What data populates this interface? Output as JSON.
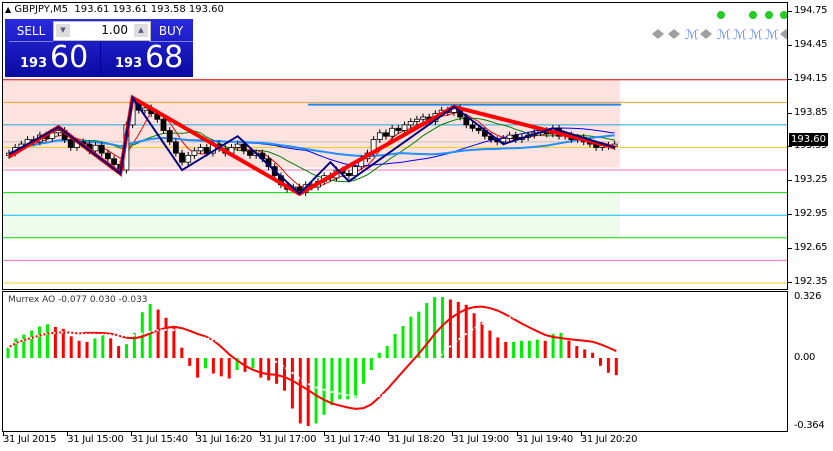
{
  "header": {
    "symbol": "GBPJPY,M5",
    "quote": "193.61 193.61 193.58 193.60"
  },
  "trade_panel": {
    "sell_label": "SELL",
    "buy_label": "BUY",
    "volume": "1.00",
    "sell_big": "193",
    "sell_pips": "60",
    "buy_big": "193",
    "buy_pips": "68"
  },
  "price_axis": [
    "194.75",
    "194.45",
    "194.15",
    "193.85",
    "193.55",
    "193.25",
    "192.95",
    "192.65",
    "192.35"
  ],
  "current_price": "193.60",
  "levels": [
    {
      "p": 194.15,
      "c": "#e00000"
    },
    {
      "p": 193.95,
      "c": "#f0a020"
    },
    {
      "p": 193.75,
      "c": "#20a8e0"
    },
    {
      "p": 193.55,
      "c": "#f0d020"
    },
    {
      "p": 193.35,
      "c": "#ff69b4"
    },
    {
      "p": 193.15,
      "c": "#00e000"
    },
    {
      "p": 192.95,
      "c": "#00bfff"
    },
    {
      "p": 192.75,
      "c": "#00e000"
    },
    {
      "p": 192.55,
      "c": "#ff69b4"
    },
    {
      "p": 192.35,
      "c": "#f0d020"
    }
  ],
  "colors": {
    "bull_zone": "#fde3e0",
    "bear_zone": "#effcec",
    "zigzag_red": "#ff0000",
    "zigzag_blue": "#000080",
    "ao_up": "#00ee00",
    "ao_down": "#ff0000"
  },
  "closes": [
    193.5,
    193.55,
    193.58,
    193.62,
    193.6,
    193.66,
    193.63,
    193.68,
    193.7,
    193.62,
    193.55,
    193.6,
    193.58,
    193.52,
    193.57,
    193.5,
    193.45,
    193.4,
    193.35,
    193.75,
    193.95,
    193.88,
    193.9,
    193.85,
    193.8,
    193.7,
    193.6,
    193.5,
    193.42,
    193.48,
    193.52,
    193.55,
    193.5,
    193.58,
    193.54,
    193.5,
    193.55,
    193.58,
    193.52,
    193.48,
    193.5,
    193.45,
    193.38,
    193.3,
    193.22,
    193.18,
    193.2,
    193.15,
    193.22,
    193.2,
    193.25,
    193.3,
    193.28,
    193.35,
    193.32,
    193.3,
    193.38,
    193.45,
    193.5,
    193.62,
    193.68,
    193.65,
    193.72,
    193.7,
    193.75,
    193.78,
    193.8,
    193.82,
    193.78,
    193.85,
    193.88,
    193.86,
    193.9,
    193.82,
    193.75,
    193.72,
    193.7,
    193.65,
    193.62,
    193.6,
    193.63,
    193.66,
    193.62,
    193.64,
    193.66,
    193.68,
    193.7,
    193.67,
    193.72,
    193.65,
    193.66,
    193.62,
    193.64,
    193.6,
    193.58,
    193.55,
    193.57,
    193.56,
    193.58
  ],
  "zigzag_red": [
    [
      0,
      193.47
    ],
    [
      8,
      193.73
    ],
    [
      18,
      193.32
    ],
    [
      20,
      193.99
    ],
    [
      47,
      193.14
    ],
    [
      72,
      193.91
    ],
    [
      98,
      193.55
    ]
  ],
  "zigzag_blue": [
    [
      0,
      193.49
    ],
    [
      8,
      193.73
    ],
    [
      18,
      193.32
    ],
    [
      20,
      193.99
    ],
    [
      28,
      193.35
    ],
    [
      37,
      193.65
    ],
    [
      47,
      193.14
    ],
    [
      52,
      193.42
    ],
    [
      55,
      193.25
    ],
    [
      72,
      193.91
    ],
    [
      80,
      193.58
    ],
    [
      88,
      193.72
    ],
    [
      98,
      193.55
    ]
  ],
  "indicator": {
    "label": "Murrex AO -0.077 0.030 -0.033",
    "axis": [
      "0.326",
      "0.00",
      "-0.364"
    ],
    "values": [
      0.055,
      0.105,
      0.125,
      0.147,
      0.169,
      0.18,
      0.166,
      0.156,
      0.116,
      0.092,
      0.086,
      0.105,
      0.123,
      0.105,
      0.064,
      0.074,
      0.134,
      0.245,
      0.289,
      0.259,
      0.215,
      0.16,
      0.055,
      -0.042,
      -0.105,
      -0.055,
      -0.083,
      -0.098,
      -0.11,
      -0.064,
      -0.074,
      -0.055,
      -0.105,
      -0.12,
      -0.138,
      -0.175,
      -0.27,
      -0.35,
      -0.364,
      -0.35,
      -0.304,
      -0.252,
      -0.221,
      -0.221,
      -0.212,
      -0.138,
      -0.064,
      0.028,
      0.064,
      0.129,
      0.171,
      0.221,
      0.248,
      0.294,
      0.326,
      0.326,
      0.313,
      0.3,
      0.285,
      0.239,
      0.193,
      0.147,
      0.11,
      0.086,
      0.086,
      0.092,
      0.092,
      0.098,
      0.092,
      0.129,
      0.134,
      0.092,
      0.064,
      0.046,
      0.028,
      -0.042,
      -0.079,
      -0.092
    ]
  },
  "time_axis": [
    "31 Jul 2015",
    "31 Jul 15:00",
    "31 Jul 15:40",
    "31 Jul 16:20",
    "31 Jul 17:00",
    "31 Jul 17:40",
    "31 Jul 18:20",
    "31 Jul 19:00",
    "31 Jul 19:40",
    "31 Jul 20:20"
  ],
  "signals": {
    "dots": 4,
    "marks": [
      "diamond",
      "diamond",
      "m",
      "diamond",
      "m",
      "m",
      "m",
      "m",
      "diamond"
    ]
  }
}
